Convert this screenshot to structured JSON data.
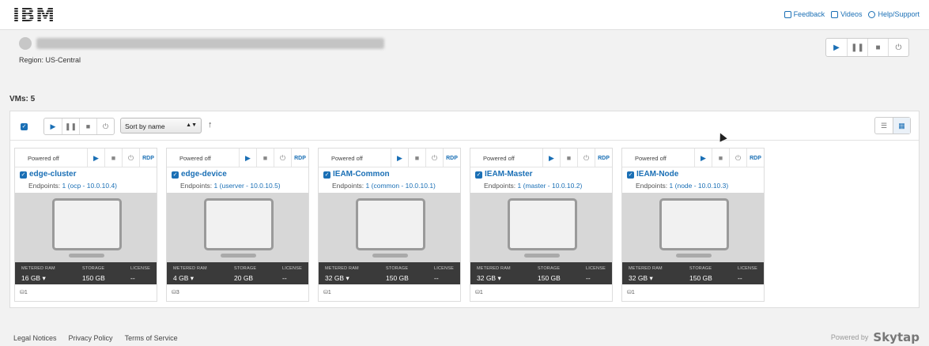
{
  "brand": {
    "logo": "IBM"
  },
  "top_links": [
    {
      "label": "Feedback",
      "icon": "feedback-icon"
    },
    {
      "label": "Videos",
      "icon": "video-camera-icon"
    },
    {
      "label": "Help/Support",
      "icon": "help-icon"
    }
  ],
  "environment": {
    "region": "Region: US-Central"
  },
  "vm_count_label": "VMs: 5",
  "toolbar": {
    "sort_value": "Sort by name",
    "sort_direction": "↑"
  },
  "vm_controls": {
    "play": "▶",
    "pause": "❚❚",
    "stop": "■",
    "power": "⏻",
    "rdp": "RDP"
  },
  "stat_labels": {
    "ram": "METERED RAM",
    "storage": "STORAGE",
    "license": "LICENSE"
  },
  "vms": [
    {
      "status": "Powered off",
      "name": "edge-cluster",
      "endpoints_label": "Endpoints:",
      "endpoints_value": "1 (ocp - 10.0.10.4)",
      "ram": "16 GB",
      "storage": "150 GB",
      "license": "--",
      "users": "1"
    },
    {
      "status": "Powered off",
      "name": "edge-device",
      "endpoints_label": "Endpoints:",
      "endpoints_value": "1 (userver - 10.0.10.5)",
      "ram": "4 GB",
      "storage": "20 GB",
      "license": "--",
      "users": "3"
    },
    {
      "status": "Powered off",
      "name": "IEAM-Common",
      "endpoints_label": "Endpoints:",
      "endpoints_value": "1 (common - 10.0.10.1)",
      "ram": "32 GB",
      "storage": "150 GB",
      "license": "--",
      "users": "1"
    },
    {
      "status": "Powered off",
      "name": "IEAM-Master",
      "endpoints_label": "Endpoints:",
      "endpoints_value": "1 (master - 10.0.10.2)",
      "ram": "32 GB",
      "storage": "150 GB",
      "license": "--",
      "users": "1"
    },
    {
      "status": "Powered off",
      "name": "IEAM-Node",
      "endpoints_label": "Endpoints:",
      "endpoints_value": "1 (node - 10.0.10.3)",
      "ram": "32 GB",
      "storage": "150 GB",
      "license": "--",
      "users": "1"
    }
  ],
  "footer": {
    "links": [
      "Legal Notices",
      "Privacy Policy",
      "Terms of Service"
    ],
    "powered_by": "Powered by",
    "brand": "Skytap"
  }
}
